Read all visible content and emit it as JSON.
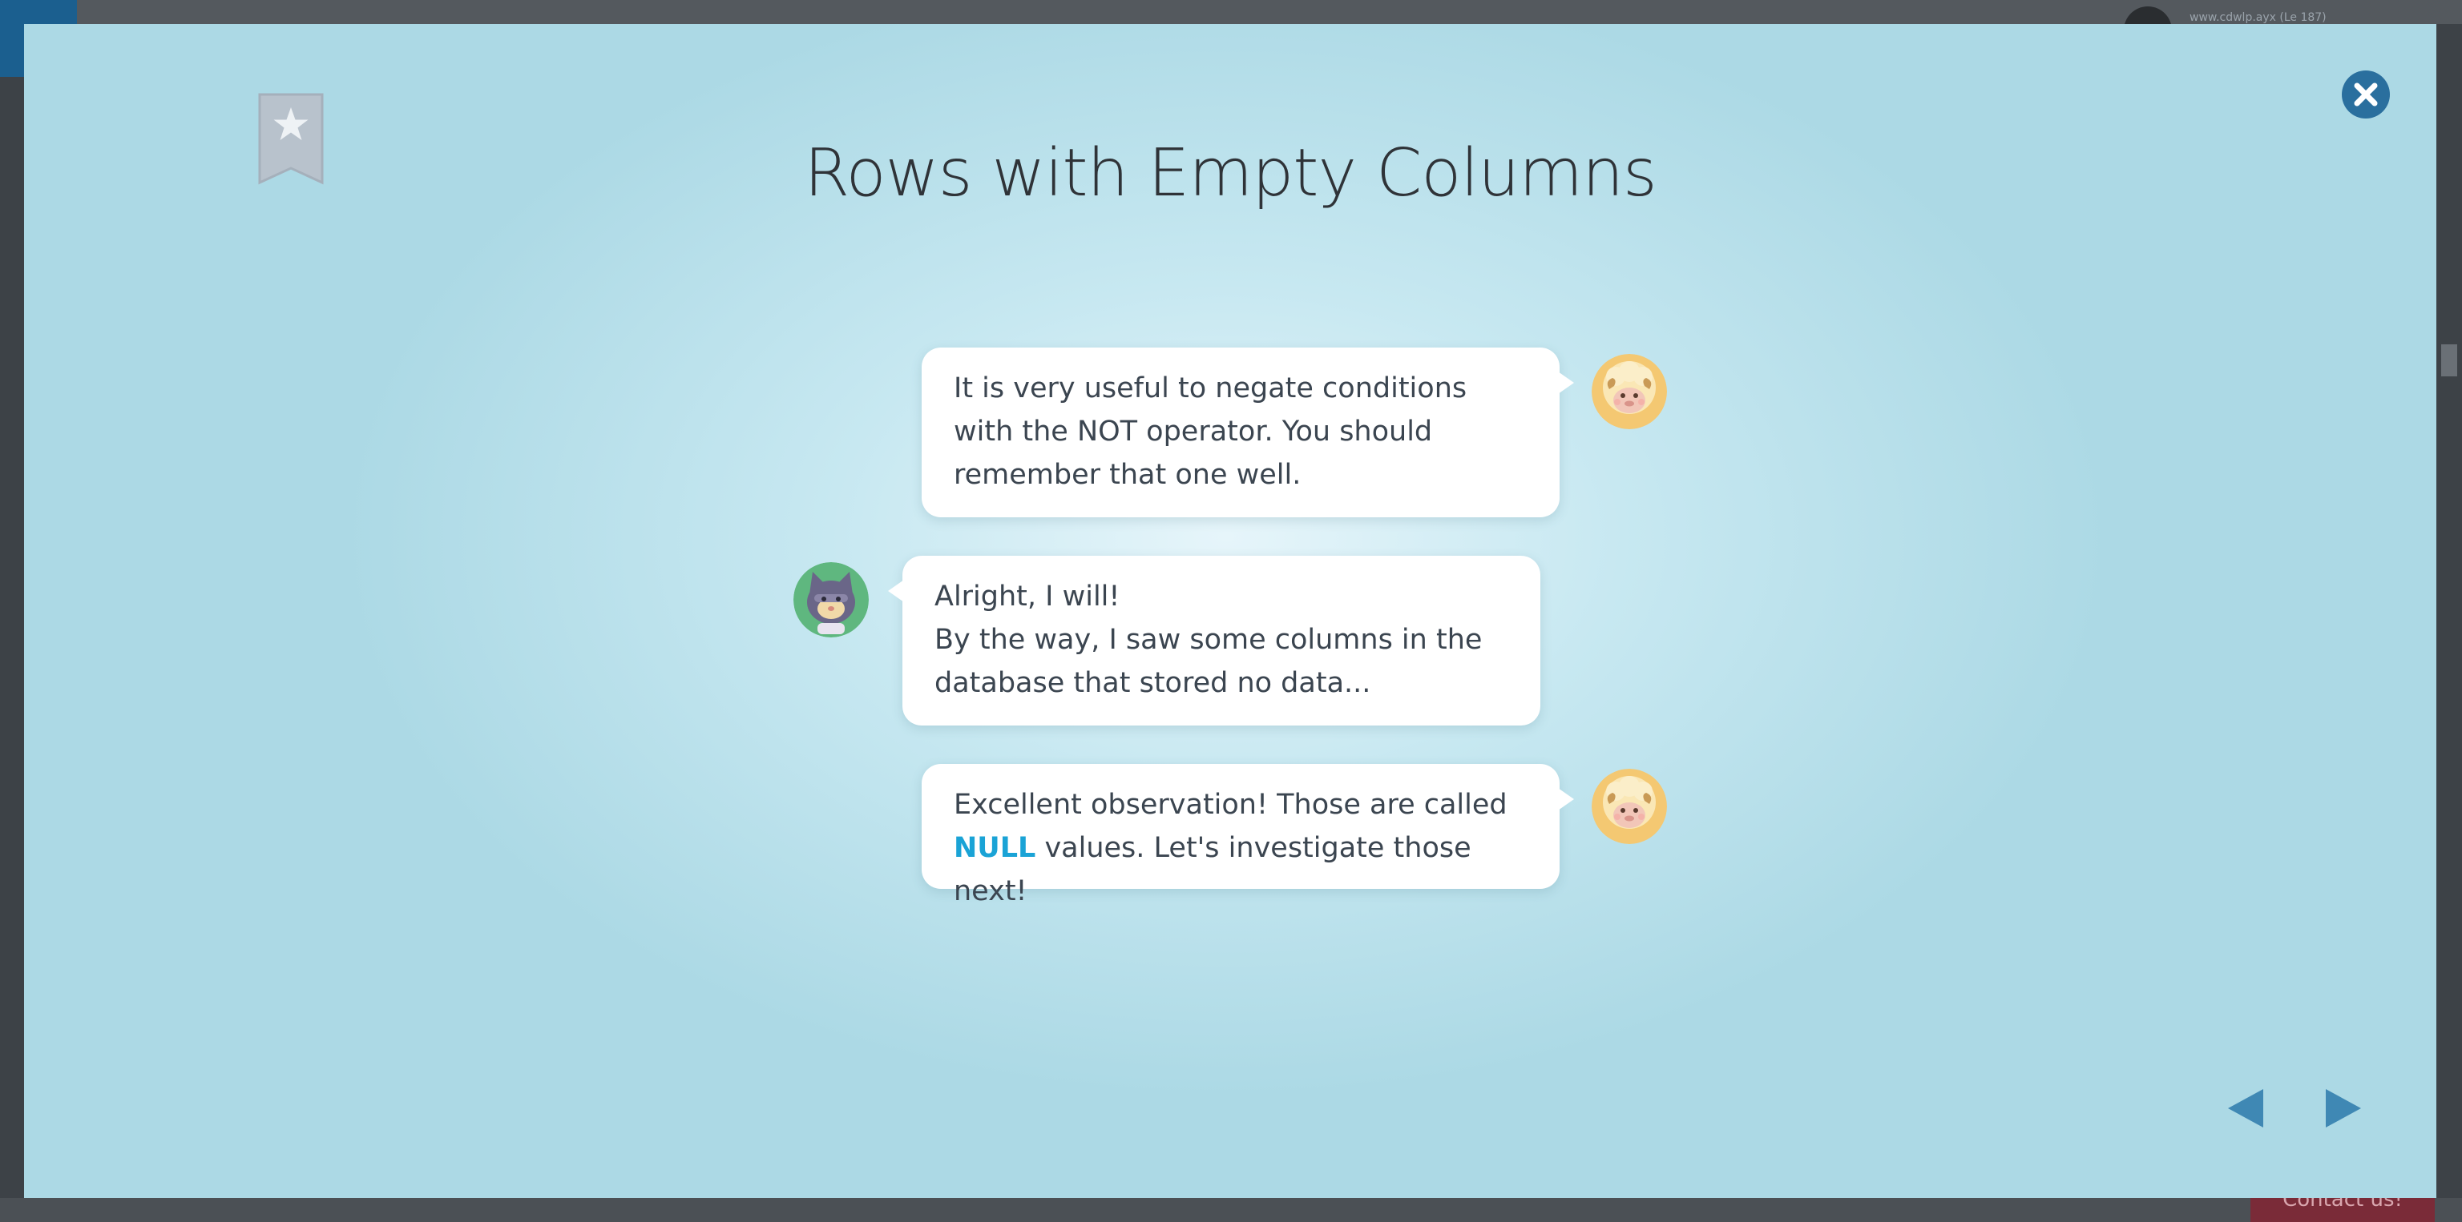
{
  "background_page": {
    "user_label": "www.cdwlp.ayx (Le 187)",
    "contact_label": "Contact us!"
  },
  "modal": {
    "title": "Rows with Empty Columns",
    "bookmark_icon": "star-bookmark-icon",
    "close_icon": "close-icon",
    "colors": {
      "accent": "#1aa3d6",
      "close_button": "#2a6f9e",
      "nav_arrow": "#3f88b4",
      "bookmark": "#b8c2cc"
    }
  },
  "dialogue": [
    {
      "speaker": "sheep",
      "side": "right",
      "text": "It is very useful to negate conditions with the NOT operator. You should remember that one well."
    },
    {
      "speaker": "cat",
      "side": "left",
      "line1": "Alright, I will!",
      "line2": "By the way, I saw some columns in the database that stored no data..."
    },
    {
      "speaker": "sheep",
      "side": "right",
      "text_before": "Excellent observation! Those are called ",
      "keyword": "NULL",
      "text_after": " values. Let's investigate those next!"
    }
  ],
  "navigation": {
    "prev_icon": "triangle-left-icon",
    "next_icon": "triangle-right-icon"
  }
}
